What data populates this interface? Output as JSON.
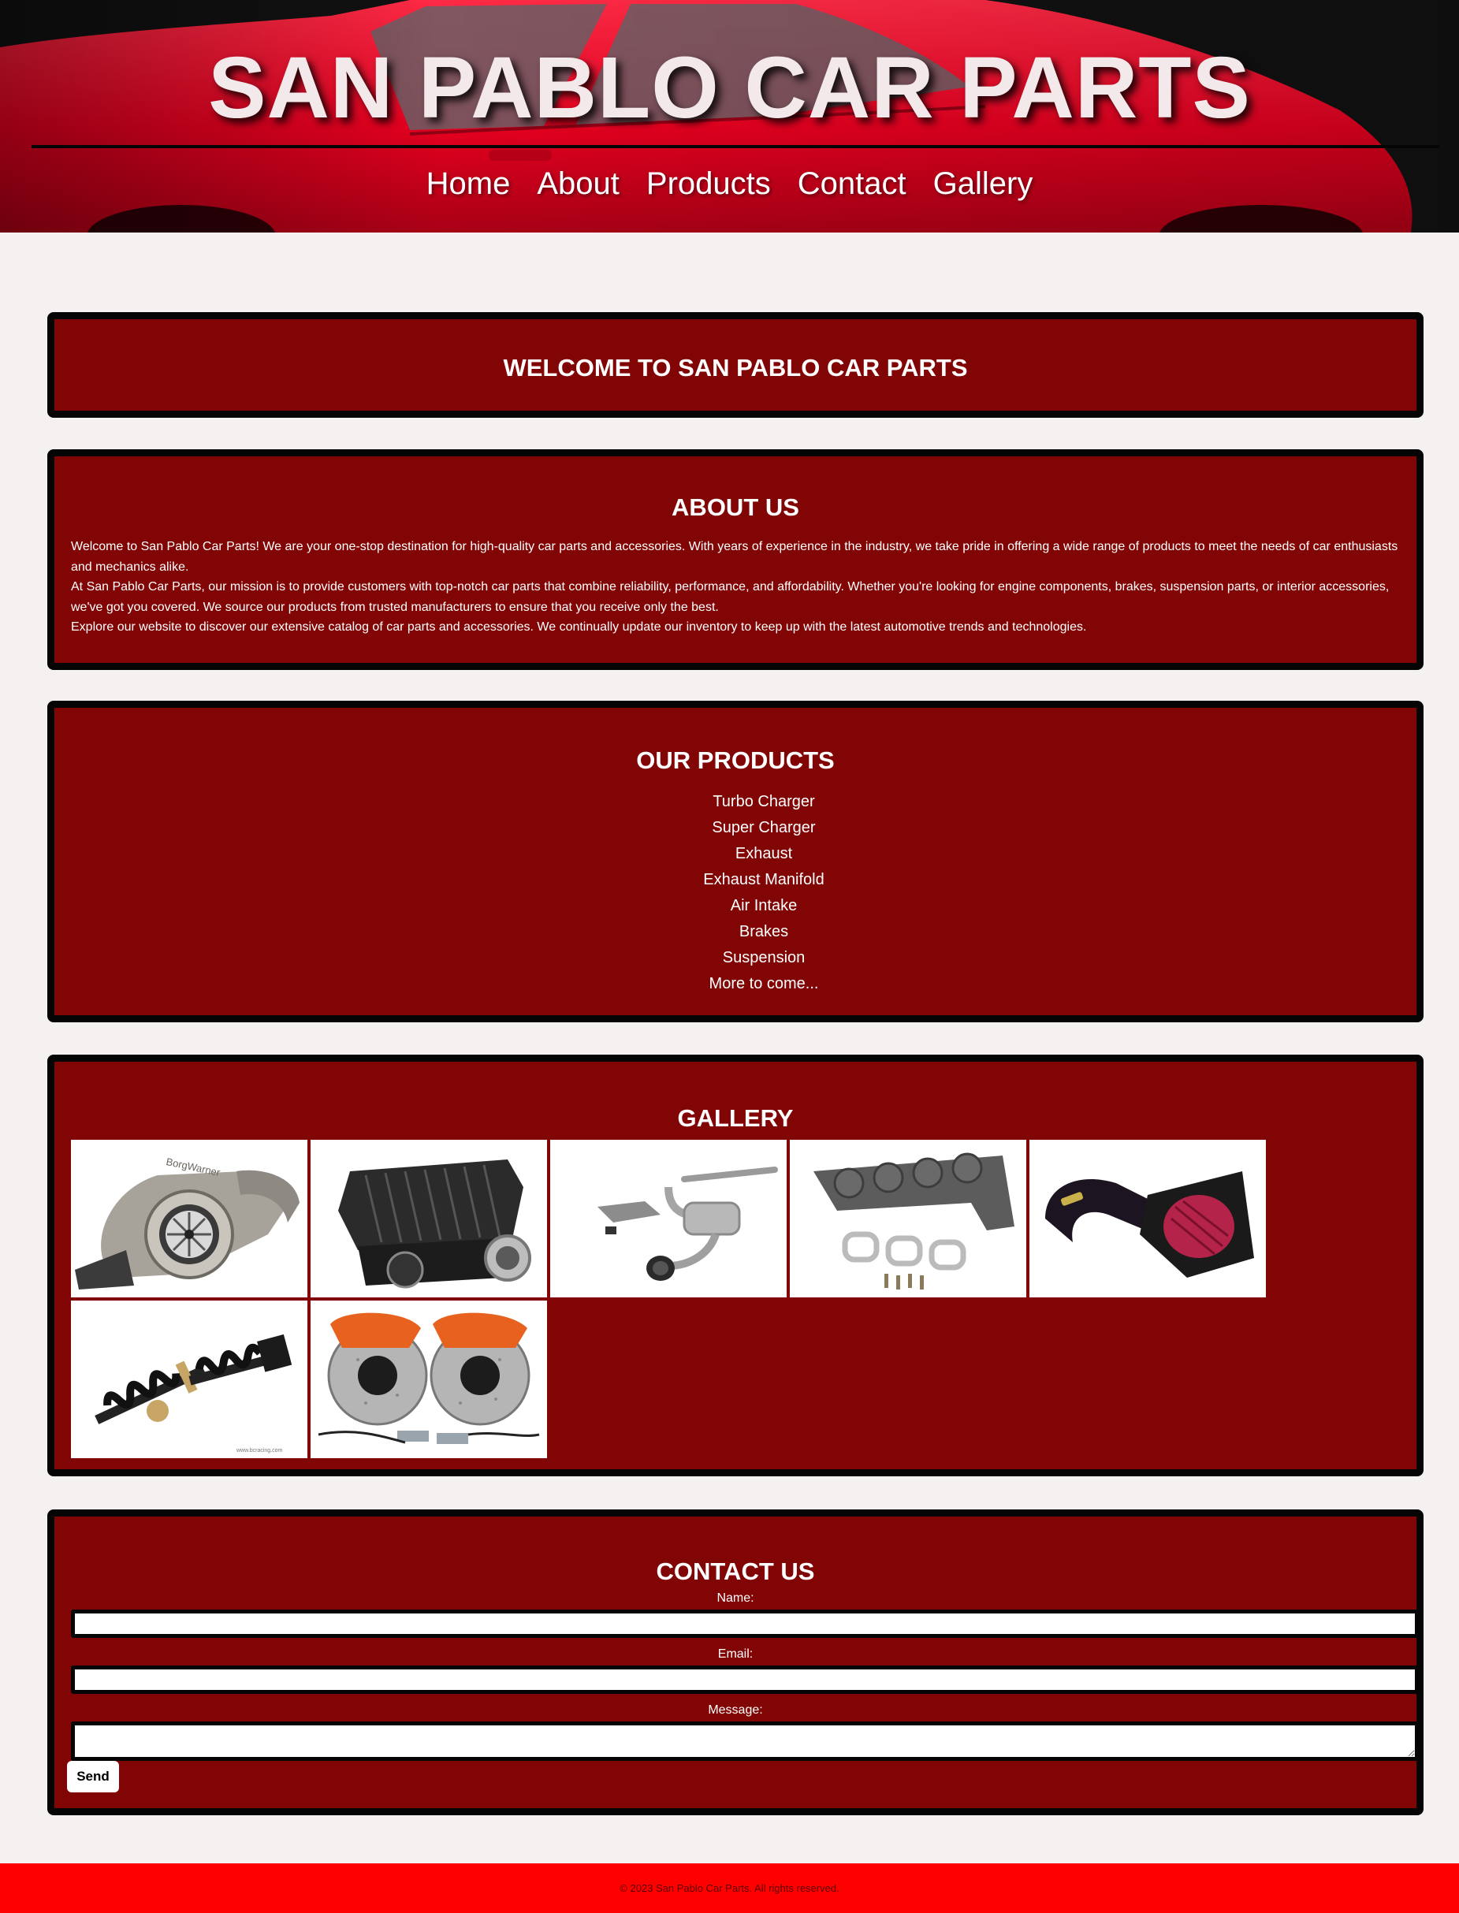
{
  "colors": {
    "page_background": "#f5f1f0",
    "section_background": "#820505",
    "section_border": "#050505",
    "footer_background": "#fe0000",
    "hero_car_red": "#ff0a2a"
  },
  "header": {
    "title": "SAN PABLO CAR PARTS",
    "nav": [
      "Home",
      "About",
      "Products",
      "Contact",
      "Gallery"
    ]
  },
  "welcome": {
    "heading": "WELCOME TO SAN PABLO CAR PARTS"
  },
  "about": {
    "heading": "ABOUT US",
    "paragraphs": [
      "Welcome to San Pablo Car Parts! We are your one-stop destination for high-quality car parts and accessories. With years of experience in the industry, we take pride in offering a wide range of products to meet the needs of car enthusiasts and mechanics alike.",
      "At San Pablo Car Parts, our mission is to provide customers with top-notch car parts that combine reliability, performance, and affordability. Whether you're looking for engine components, brakes, suspension parts, or interior accessories, we've got you covered. We source our products from trusted manufacturers to ensure that you receive only the best.",
      "Explore our website to discover our extensive catalog of car parts and accessories. We continually update our inventory to keep up with the latest automotive trends and technologies."
    ]
  },
  "products": {
    "heading": "OUR PRODUCTS",
    "items": [
      "Turbo Charger",
      "Super Charger",
      "Exhaust",
      "Exhaust Manifold",
      "Air Intake",
      "Brakes",
      "Suspension",
      "More to come..."
    ]
  },
  "gallery": {
    "heading": "GALLERY",
    "images": [
      {
        "icon": "turbocharger-icon"
      },
      {
        "icon": "supercharger-icon"
      },
      {
        "icon": "exhaust-icon"
      },
      {
        "icon": "exhaust-manifold-icon"
      },
      {
        "icon": "air-intake-icon"
      },
      {
        "icon": "coilover-suspension-icon"
      },
      {
        "icon": "brake-kit-icon"
      }
    ]
  },
  "contact": {
    "heading": "CONTACT US",
    "name_label": "Name:",
    "email_label": "Email:",
    "message_label": "Message:",
    "send_label": "Send"
  },
  "footer": {
    "text": "© 2023 San Pablo Car Parts. All rights reserved."
  }
}
